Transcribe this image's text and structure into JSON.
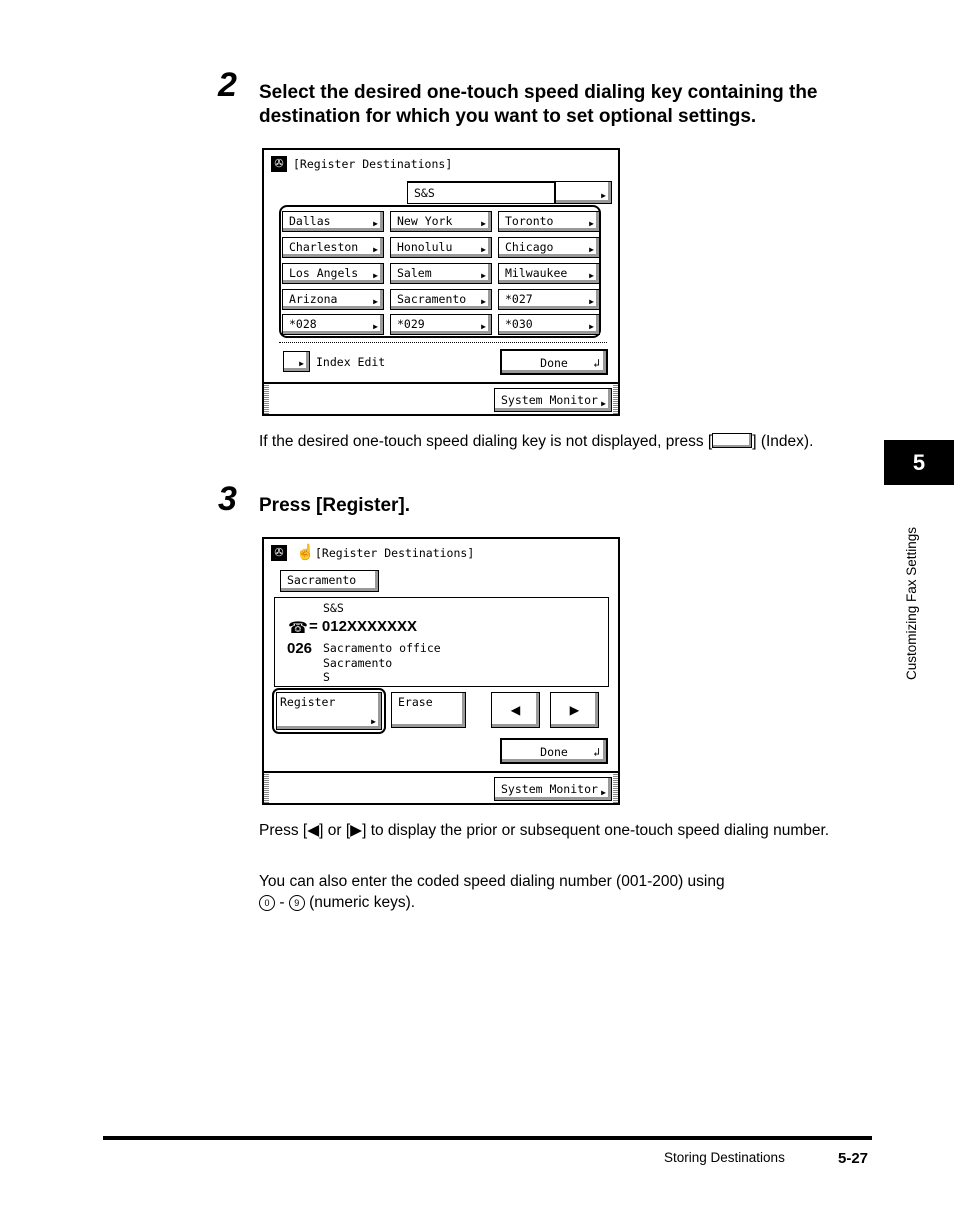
{
  "step2": {
    "number": "2",
    "heading_line1": "Select the desired one-touch speed dialing key containing the",
    "heading_line2": "destination for which you want to set optional settings.",
    "screen": {
      "title": "[Register Destinations]",
      "field_value": "S&S",
      "keys": [
        "Dallas",
        "New York",
        "Toronto",
        "Charleston",
        "Honolulu",
        "Chicago",
        "Los Angels",
        "Salem",
        "Milwaukee",
        "Arizona",
        "Sacramento",
        "*027",
        "*028",
        "*029",
        "*030"
      ],
      "index_edit": "Index Edit",
      "done": "Done",
      "system_monitor": "System Monitor"
    },
    "note_before": "If the desired one-touch speed dialing key is not displayed, press [",
    "note_after": "] (Index)."
  },
  "step3": {
    "number": "3",
    "heading": "Press [Register].",
    "screen": {
      "title": "[Register Destinations]",
      "name_button": "Sacramento",
      "info_name": "S&S",
      "info_number": "= 012XXXXXXX",
      "info_code": "026",
      "info_line1": "Sacramento office",
      "info_line2": "Sacramento",
      "info_line3": "S",
      "register": "Register",
      "erase": "Erase",
      "done": "Done",
      "system_monitor": "System Monitor"
    },
    "note1": "Press [◀] or [▶] to display the prior or subsequent one-touch speed dialing number.",
    "note2_line1": "You can also enter the coded speed dialing number (001-200) using",
    "note2_key0": "0",
    "note2_sep": "-",
    "note2_key9": "9",
    "note2_after": "(numeric keys)."
  },
  "side_tab": {
    "chapter": "5",
    "label": "Customizing Fax Settings"
  },
  "footer": {
    "section": "Storing Destinations",
    "page": "5-27"
  }
}
